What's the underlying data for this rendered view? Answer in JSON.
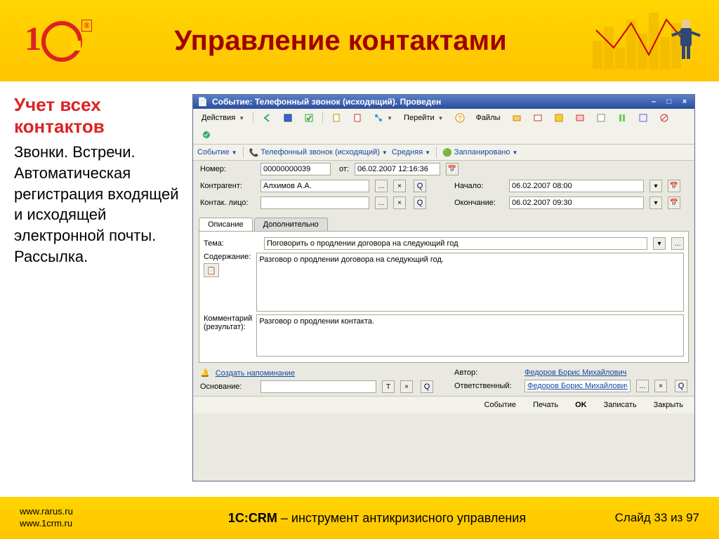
{
  "slide": {
    "title": "Управление контактами",
    "heading": "Учет всех контактов",
    "body": "Звонки. Встречи. Автоматическая регистрация входящей и исходящей электронной почты. Рассылка."
  },
  "footer": {
    "site1": "www.rarus.ru",
    "site2": "www.1crm.ru",
    "product": "1С:CRM",
    "tagline": " – инструмент антикризисного управления",
    "slide_label": "Слайд 33 из 97"
  },
  "window": {
    "title": "Событие: Телефонный звонок (исходящий). Проведен",
    "actions_label": "Действия",
    "goto_label": "Перейти",
    "files_label": "Файлы",
    "bar2": {
      "event": "Событие",
      "type": "Телефонный звонок  (исходящий)",
      "priority": "Средняя",
      "status": "Запланировано"
    },
    "fields": {
      "number_label": "Номер:",
      "number_value": "00000000039",
      "from_label": "от:",
      "from_value": "06.02.2007 12:16:36",
      "contragent_label": "Контрагент:",
      "contragent_value": "Алхимов А.А.",
      "contact_label": "Контак. лицо:",
      "contact_value": "",
      "start_label": "Начало:",
      "start_value": "06.02.2007 08:00",
      "end_label": "Окончание:",
      "end_value": "06.02.2007 09:30"
    },
    "tabs": {
      "t1": "Описание",
      "t2": "Дополнительно"
    },
    "desc": {
      "subject_label": "Тема:",
      "subject_value": "Поговорить о продлении договора на следующий год",
      "content_label": "Содержание:",
      "content_value": "Разговор о продлении договора на следующий год.",
      "comment_label": "Комментарий (результат):",
      "comment_value": "Разговор о продлении контакта."
    },
    "foot": {
      "reminder": "Создать напоминание",
      "basis_label": "Основание:",
      "author_label": "Автор:",
      "author_value": "Федоров Борис Михайлович",
      "resp_label": "Ответственный:",
      "resp_value": "Федоров Борис Михайлович"
    },
    "status": {
      "event": "Событие",
      "print": "Печать",
      "ok": "OK",
      "save": "Записать",
      "close": "Закрыть"
    }
  }
}
